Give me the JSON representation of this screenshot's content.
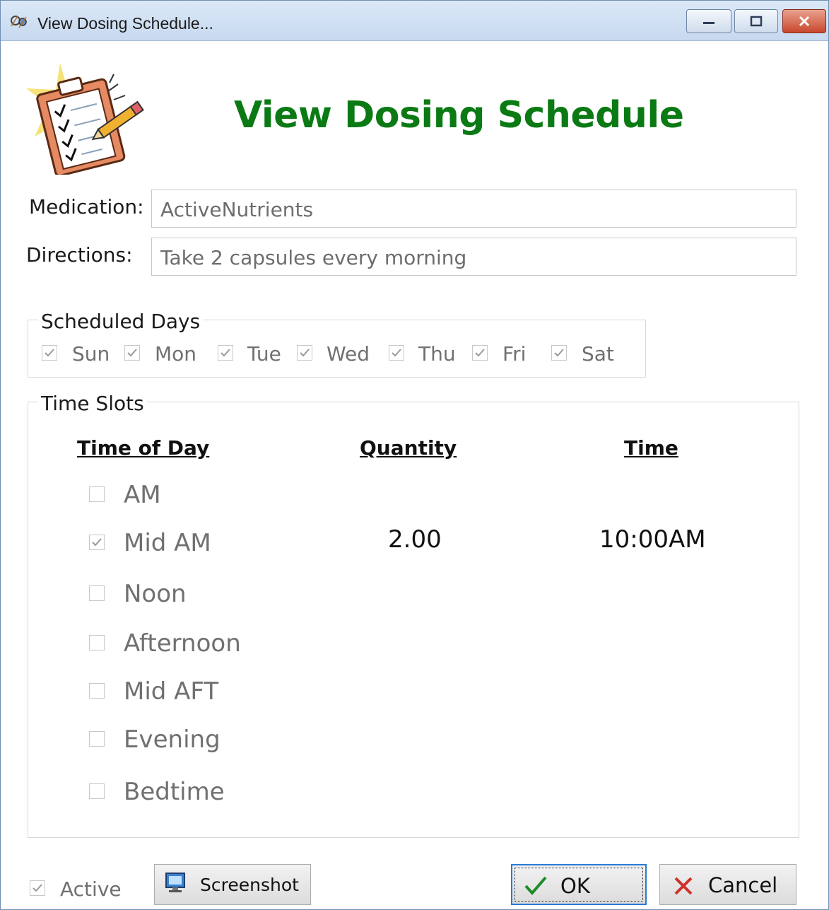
{
  "window": {
    "title": "View Dosing Schedule..."
  },
  "heading": "View Dosing Schedule",
  "medication": {
    "label": "Medication:",
    "value": "ActiveNutrients"
  },
  "directions": {
    "label": "Directions:",
    "value": "Take 2 capsules every morning"
  },
  "scheduled_days": {
    "legend": "Scheduled Days",
    "days": [
      {
        "label": "Sun",
        "checked": true
      },
      {
        "label": "Mon",
        "checked": true
      },
      {
        "label": "Tue",
        "checked": true
      },
      {
        "label": "Wed",
        "checked": true
      },
      {
        "label": "Thu",
        "checked": true
      },
      {
        "label": "Fri",
        "checked": true
      },
      {
        "label": "Sat",
        "checked": true
      }
    ]
  },
  "time_slots": {
    "legend": "Time Slots",
    "headers": {
      "time_of_day": "Time of Day",
      "quantity": "Quantity",
      "time": "Time"
    },
    "slots": [
      {
        "label": "AM",
        "checked": false,
        "quantity": "",
        "time": ""
      },
      {
        "label": "Mid AM",
        "checked": true,
        "quantity": "2.00",
        "time": "10:00AM"
      },
      {
        "label": "Noon",
        "checked": false,
        "quantity": "",
        "time": ""
      },
      {
        "label": "Afternoon",
        "checked": false,
        "quantity": "",
        "time": ""
      },
      {
        "label": "Mid AFT",
        "checked": false,
        "quantity": "",
        "time": ""
      },
      {
        "label": "Evening",
        "checked": false,
        "quantity": "",
        "time": ""
      },
      {
        "label": "Bedtime",
        "checked": false,
        "quantity": "",
        "time": ""
      }
    ]
  },
  "footer": {
    "active": {
      "label": "Active",
      "checked": true
    },
    "screenshot_label": "Screenshot",
    "ok_label": "OK",
    "cancel_label": "Cancel"
  }
}
